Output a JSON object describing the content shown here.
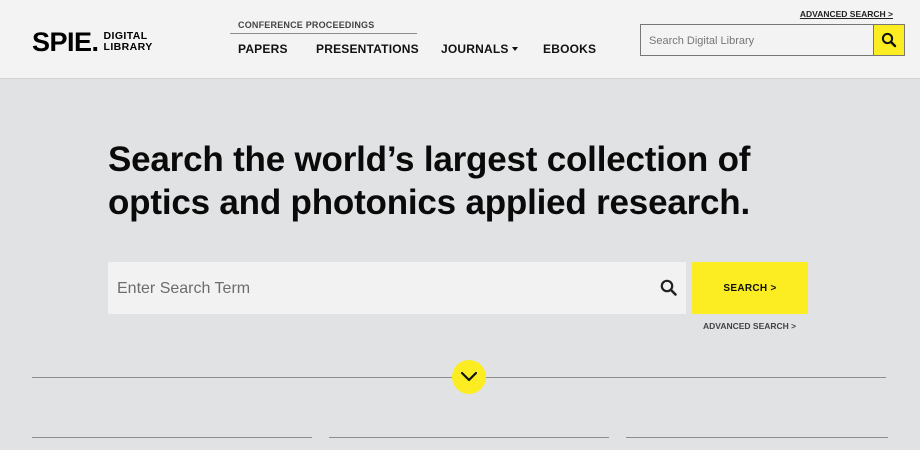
{
  "header": {
    "logo_mark": "SPIE",
    "logo_dot": ".",
    "logo_sub_1": "DIGITAL",
    "logo_sub_2": "LIBRARY",
    "conference_label": "CONFERENCE PROCEEDINGS",
    "nav": {
      "papers": "PAPERS",
      "presentations": "PRESENTATIONS",
      "journals": "JOURNALS",
      "ebooks": "EBOOKS"
    },
    "advanced_search": "ADVANCED SEARCH >",
    "search_placeholder": "Search Digital Library"
  },
  "hero": {
    "headline_line1": "Search the world’s largest collection of",
    "headline_line2": "optics and photonics applied research.",
    "search_placeholder": "Enter Search Term",
    "search_button": "SEARCH >",
    "advanced_search": "ADVANCED SEARCH >"
  },
  "icons": {
    "header_search": "search-icon",
    "hero_search": "search-icon",
    "expand": "chevron-down-icon",
    "journals_dropdown": "caret-down-icon"
  },
  "colors": {
    "accent": "#fbed21",
    "page_bg": "#e1e2e3",
    "header_bg": "#f3f3f3"
  }
}
